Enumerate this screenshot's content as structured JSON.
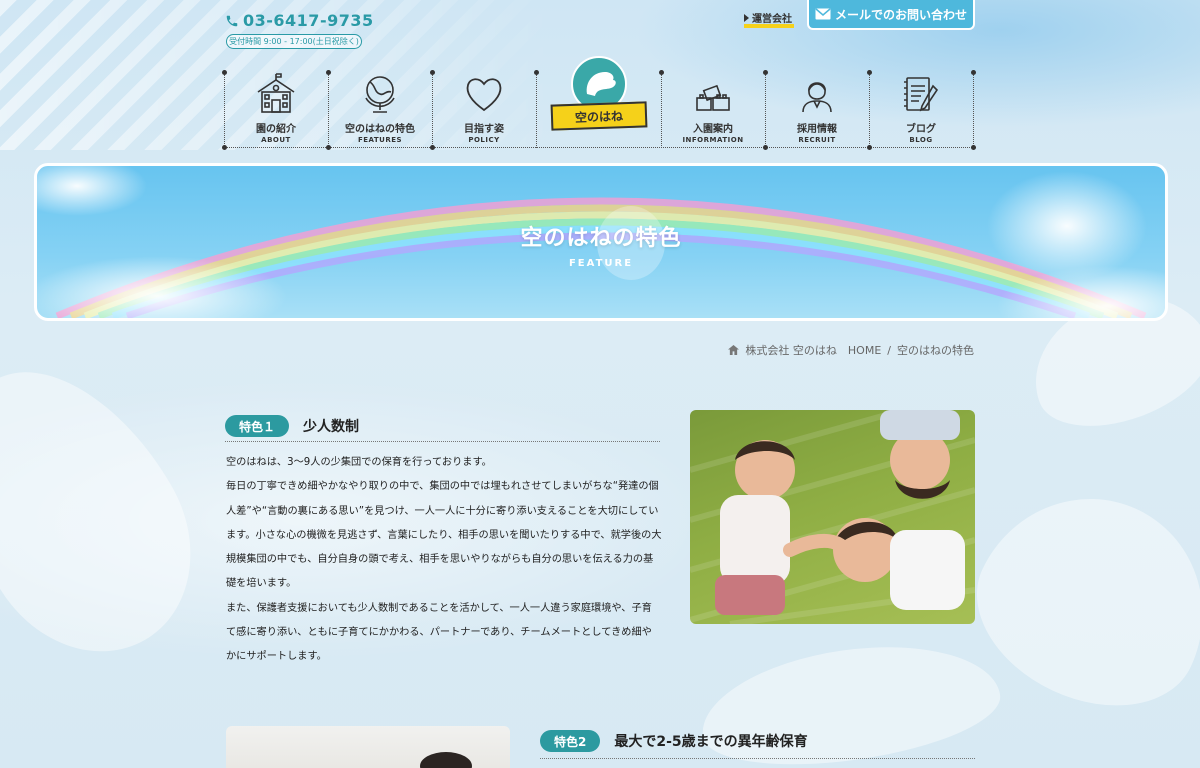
{
  "header": {
    "phone": "03-6417-9735",
    "hours": "受付時間 9:00 - 17:00(土日祝除く)",
    "company_link": "運営会社",
    "mail_button": "メールでのお問い合わせ"
  },
  "nav": {
    "items": [
      {
        "ja": "園の紹介",
        "en": "ABOUT",
        "icon": "school-building-icon"
      },
      {
        "ja": "空のはねの特色",
        "en": "FEATURES",
        "icon": "globe-icon"
      },
      {
        "ja": "目指す姿",
        "en": "POLICY",
        "icon": "heart-icon"
      },
      {
        "ja": "入園案内",
        "en": "INFORMATION",
        "icon": "blocks-icon"
      },
      {
        "ja": "採用情報",
        "en": "RECRUIT",
        "icon": "staff-person-icon"
      },
      {
        "ja": "ブログ",
        "en": "BLOG",
        "icon": "notepad-icon"
      }
    ],
    "logo_text": "空のはね"
  },
  "hero": {
    "title": "空のはねの特色",
    "subtitle": "FEATURE"
  },
  "breadcrumb": {
    "home": "株式会社 空のはね　HOME",
    "separator": "/",
    "current": "空のはねの特色"
  },
  "feature1": {
    "badge": "特色１",
    "title": "少人数制",
    "paragraphs": [
      "空のはねは、3〜9人の少集団での保育を行っております。",
      "毎日の丁寧できめ細やかなやり取りの中で、集団の中では埋もれさせてしまいがちな“発達の個人差”や“言動の裏にある思い”を見つけ、一人一人に十分に寄り添い支えることを大切にしています。小さな心の機微を見逃さず、言葉にしたり、相手の思いを聞いたりする中で、就学後の大規模集団の中でも、自分自身の頭で考え、相手を思いやりながらも自分の思いを伝える力の基礎を培います。",
      "また、保護者支援においても少人数制であることを活かして、一人一人違う家庭環境や、子育て感に寄り添い、ともに子育てにかかわる、パートナーであり、チームメートとしてきめ細やかにサポートします。"
    ]
  },
  "feature2": {
    "badge": "特色2",
    "title": "最大で2-5歳までの異年齢保育"
  },
  "colors": {
    "accent_teal": "#2c9aa0",
    "phone_teal": "#2a9aa6",
    "mail_blue": "#4eb8dc",
    "ribbon_yellow": "#f5d11a"
  }
}
